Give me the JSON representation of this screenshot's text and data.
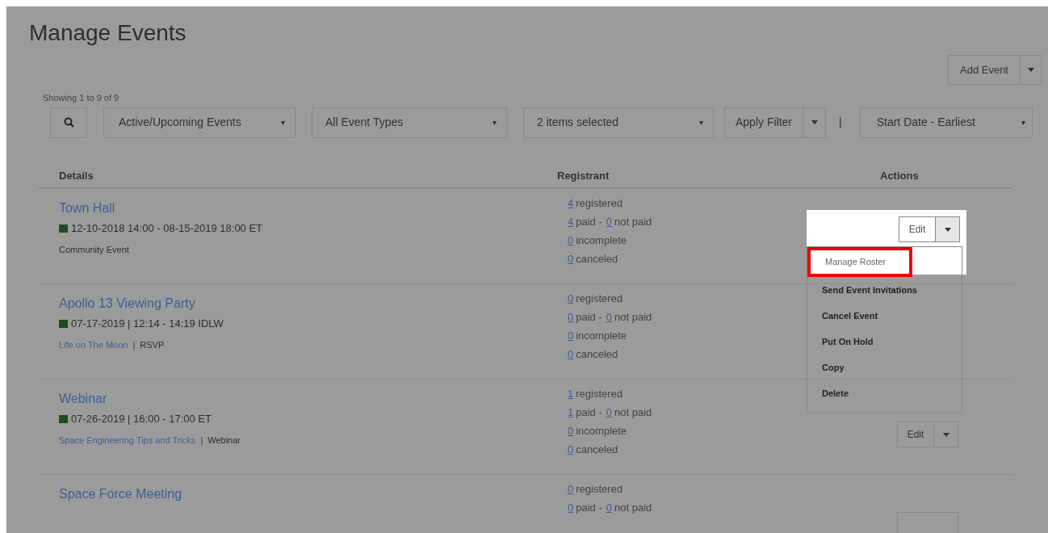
{
  "title": "Manage Events",
  "add_event": {
    "label": "Add Event"
  },
  "showing": "Showing 1 to 9 of 9",
  "filters": [
    {
      "value": "Active/Upcoming Events",
      "caret": "▾"
    },
    {
      "value": "All Event Types",
      "caret": "▾"
    },
    {
      "value": "2 items selected",
      "caret": "▾"
    }
  ],
  "apply_filter": {
    "label": "Apply Filter"
  },
  "separator": "|",
  "sort": {
    "value": "Start Date - Earliest",
    "caret": "▾"
  },
  "columns": [
    "Details",
    "Registrant",
    "Actions"
  ],
  "rows": [
    {
      "title": "Town Hall",
      "date": "12-10-2018 14:00 - 08-15-2019 18:00 ET",
      "meta": [
        {
          "kind": "plain",
          "text": "Community Event"
        }
      ],
      "registrant": [
        {
          "count": "4",
          "label": "registered"
        },
        {
          "count": "4",
          "label": "paid -",
          "count2": "0",
          "label2": "not paid"
        },
        {
          "count": "0",
          "label": "incomplete"
        },
        {
          "count": "0",
          "label": "canceled"
        }
      ],
      "action": {
        "kind": "menu",
        "label": "Edit"
      }
    },
    {
      "title": "Apollo 13 Viewing Party",
      "date": "07-17-2019 | 12:14 - 14:19 IDLW",
      "meta": [
        {
          "kind": "link",
          "text": "Life on The Moon"
        },
        {
          "kind": "plain",
          "text": "RSVP"
        }
      ],
      "registrant": [
        {
          "count": "0",
          "label": "registered"
        },
        {
          "count": "0",
          "label": "paid -",
          "count2": "0",
          "label2": "not paid"
        },
        {
          "count": "0",
          "label": "incomplete"
        },
        {
          "count": "0",
          "label": "canceled"
        }
      ],
      "action": {
        "kind": "covered"
      }
    },
    {
      "title": "Webinar",
      "date": "07-26-2019 | 16:00 - 17:00 ET",
      "meta": [
        {
          "kind": "link",
          "text": "Space Engineering Tips and Tricks"
        },
        {
          "kind": "plain",
          "text": "Webinar"
        }
      ],
      "registrant": [
        {
          "count": "1",
          "label": "registered"
        },
        {
          "count": "1",
          "label": "paid -",
          "count2": "0",
          "label2": "not paid"
        },
        {
          "count": "0",
          "label": "incomplete"
        },
        {
          "count": "0",
          "label": "canceled"
        }
      ],
      "action": {
        "kind": "button",
        "label": "Edit"
      }
    },
    {
      "title": "Space Force Meeting",
      "meta": [],
      "registrant": [
        {
          "count": "0",
          "label": "registered"
        },
        {
          "count": "0",
          "label": "paid -",
          "count2": "0",
          "label2": "not paid"
        }
      ],
      "action": {
        "kind": "cut"
      }
    }
  ],
  "menu": [
    {
      "label": "Manage Roster",
      "selected": true
    },
    {
      "label": "Send Event Invitations",
      "selected": false
    },
    {
      "label": "Cancel Event",
      "selected": false
    },
    {
      "label": "Put On Hold",
      "selected": false
    },
    {
      "label": "Copy",
      "selected": false
    },
    {
      "label": "Delete",
      "selected": false
    }
  ]
}
